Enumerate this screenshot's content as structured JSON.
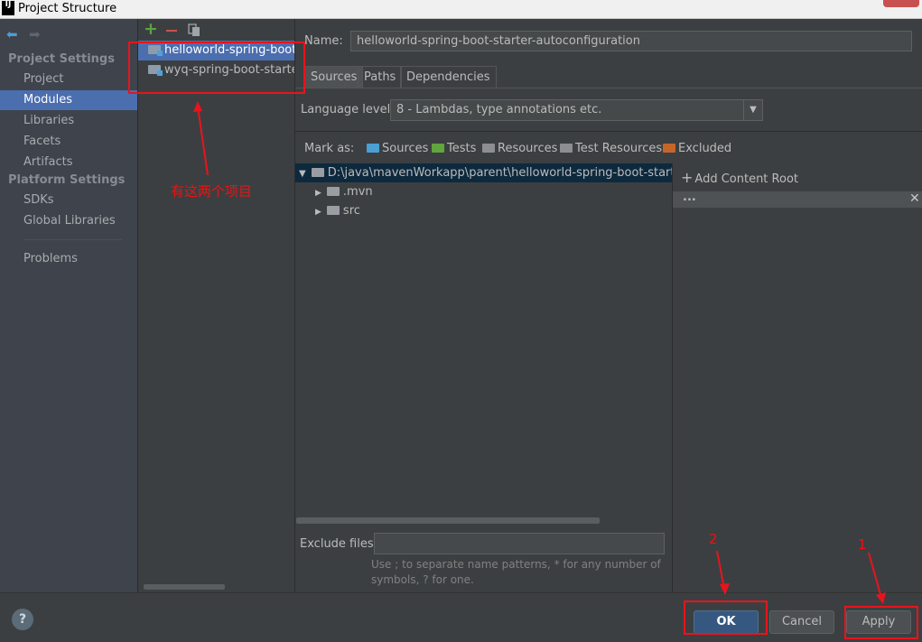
{
  "window": {
    "title": "Project Structure",
    "logo_text": "IJ"
  },
  "sidebar": {
    "sections": [
      {
        "heading": "Project Settings",
        "items": [
          "Project",
          "Modules",
          "Libraries",
          "Facets",
          "Artifacts"
        ]
      },
      {
        "heading": "Platform Settings",
        "items": [
          "SDKs",
          "Global Libraries"
        ]
      }
    ],
    "extra_items": [
      "Problems"
    ],
    "selected": "Modules"
  },
  "modules": {
    "toolbar_icons": [
      "add-icon",
      "remove-icon",
      "copy-icon"
    ],
    "items": [
      {
        "label": "helloworld-spring-boot-starter-autoconfiguration",
        "selected": true
      },
      {
        "label": "wyq-spring-boot-starter",
        "selected": false
      }
    ]
  },
  "detail": {
    "name_label": "Name:",
    "name_value": "helloworld-spring-boot-starter-autoconfiguration",
    "tabs": [
      "Sources",
      "Paths",
      "Dependencies"
    ],
    "active_tab": "Sources",
    "language_label": "Language level:",
    "language_value": "8 - Lambdas, type annotations etc.",
    "mark_as_label": "Mark as:",
    "mark_as": [
      {
        "label": "Sources",
        "color": "#4a9fd5",
        "icon": "sources-folder-icon"
      },
      {
        "label": "Tests",
        "color": "#62a43d",
        "icon": "tests-folder-icon"
      },
      {
        "label": "Resources",
        "color": "#8c8e91",
        "icon": "resources-folder-icon"
      },
      {
        "label": "Test Resources",
        "color": "#8c8e91",
        "icon": "test-resources-folder-icon"
      },
      {
        "label": "Excluded",
        "color": "#c4662b",
        "icon": "excluded-folder-icon"
      }
    ],
    "tree": {
      "root": "D:\\java\\mavenWorkapp\\parent\\helloworld-spring-boot-starter-autoconfiguration",
      "children": [
        ".mvn",
        "src"
      ]
    },
    "add_content_root": "Add Content Root",
    "content_root_text": "...",
    "exclude_label": "Exclude files:",
    "exclude_value": "",
    "exclude_hint": "Use ; to separate name patterns, * for any number of symbols, ? for one."
  },
  "footer": {
    "help": "?",
    "ok": "OK",
    "cancel": "Cancel",
    "apply": "Apply"
  },
  "annotations": {
    "modules_note": "有这两个项目",
    "step_1": "1",
    "step_2": "2"
  },
  "colors": {
    "selection": "#4b6eaf",
    "annotation_red": "#e8141d",
    "primary_button": "#365880"
  }
}
